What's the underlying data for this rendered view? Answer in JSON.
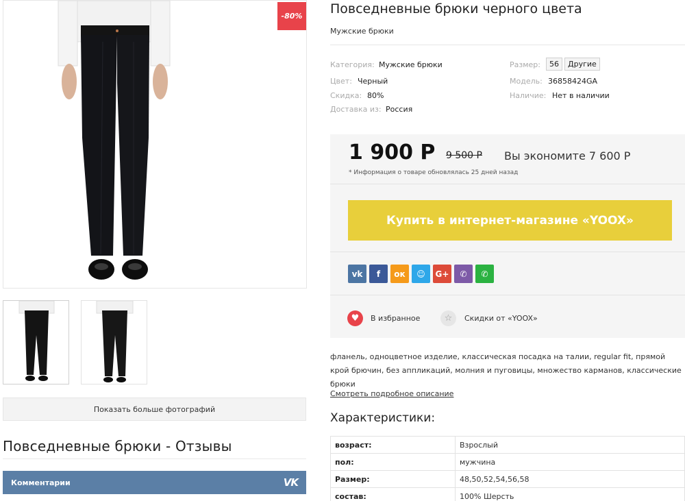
{
  "product": {
    "title": "Повседневные брюки черного цвета",
    "subtitle": "Мужские брюки",
    "discount_badge": "-80%"
  },
  "gallery": {
    "more_photos_label": "Показать больше фотографий"
  },
  "reviews": {
    "title": "Повседневные брюки - Отзывы",
    "comments_label": "Комментарии",
    "vk_logo": "VK"
  },
  "specs": {
    "category_label": "Категория:",
    "category_value": "Мужские брюки",
    "color_label": "Цвет:",
    "color_value": "Черный",
    "discount_label": "Скидка:",
    "discount_value": "80%",
    "delivery_label": "Доставка из:",
    "delivery_value": "Россия",
    "size_label": "Размер:",
    "size_value": "56",
    "size_other": "Другие",
    "model_label": "Модель:",
    "model_value": "36858424GA",
    "availability_label": "Наличие:",
    "availability_value": "Нет в наличии"
  },
  "price": {
    "current": "1 900 Р",
    "old": "9 500 Р",
    "savings": "Вы экономите 7 600 Р",
    "note": "* Информация о товаре обновлялась 25 дней назад"
  },
  "buy_button": "Купить в интернет-магазине «YOOX»",
  "share": [
    {
      "name": "vk",
      "glyph": "vk",
      "color": "#4c75a3"
    },
    {
      "name": "facebook",
      "glyph": "f",
      "color": "#3b5998"
    },
    {
      "name": "odnoklassniki",
      "glyph": "ок",
      "color": "#f59a1a"
    },
    {
      "name": "moimir",
      "glyph": "☺",
      "color": "#2ea7e9"
    },
    {
      "name": "googleplus",
      "glyph": "G+",
      "color": "#dd4b39"
    },
    {
      "name": "viber",
      "glyph": "✆",
      "color": "#7d5aa7"
    },
    {
      "name": "whatsapp",
      "glyph": "✆",
      "color": "#2bb241"
    }
  ],
  "actions": {
    "favorite_label": "В избранное",
    "discounts_label": "Скидки от «YOOX»"
  },
  "description": {
    "text": "фланель, одноцветное изделие, классическая посадка на талии, regular fit, прямой крой брючин, без аппликаций, молния и пуговицы, множество карманов, классические брюки",
    "link": "Смотреть подробное описание"
  },
  "characteristics": {
    "title": "Характеристики:",
    "rows": [
      {
        "k": "возраст:",
        "v": "Взрослый"
      },
      {
        "k": "пол:",
        "v": "мужчина"
      },
      {
        "k": "Размер:",
        "v": "48,50,52,54,56,58"
      },
      {
        "k": "состав:",
        "v": "100% Шерсть"
      }
    ]
  }
}
